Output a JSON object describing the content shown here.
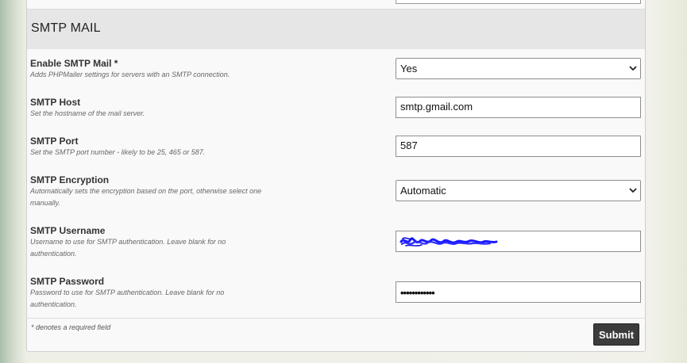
{
  "section": {
    "title": "SMTP MAIL"
  },
  "rows": [
    {
      "label": "Enable SMTP Mail *",
      "description": "Adds PHPMailer settings for servers with an SMTP connection.",
      "control": "select",
      "value": "Yes"
    },
    {
      "label": "SMTP Host",
      "description": "Set the hostname of the mail server.",
      "control": "text",
      "value": "smtp.gmail.com"
    },
    {
      "label": "SMTP Port",
      "description": "Set the SMTP port number - likely to be 25, 465 or 587.",
      "control": "text",
      "value": "587"
    },
    {
      "label": "SMTP Encryption",
      "description": "Automatically sets the encryption based on the port, otherwise select one manually.",
      "control": "select",
      "value": "Automatic"
    },
    {
      "label": "SMTP Username",
      "description": "Username to use for SMTP authentication. Leave blank for no authentication.",
      "control": "text",
      "value": ""
    },
    {
      "label": "SMTP Password",
      "description": "Password to use for SMTP authentication. Leave blank for no authentication.",
      "control": "password",
      "value": "••••••••••••"
    }
  ],
  "footer": {
    "required_note": "* denotes a required field",
    "submit_label": "Submit"
  },
  "icons": {
    "select_arrow": "chevron-down-icon",
    "redaction": "redaction-scribble-icon"
  },
  "colors": {
    "header_bg": "#e6e6e6",
    "panel_bg": "#f9f9f9",
    "submit_bg": "#3c3c3c",
    "redaction_ink": "#1a1aff"
  }
}
